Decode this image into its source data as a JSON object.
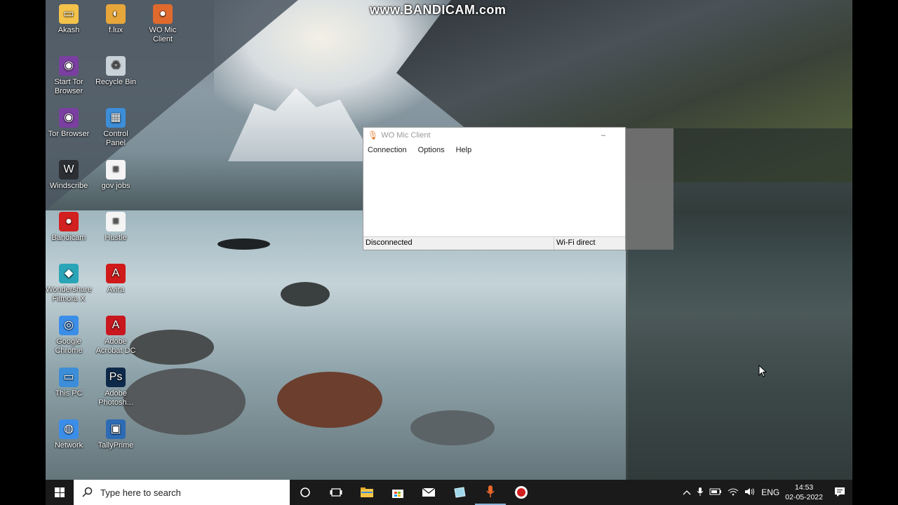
{
  "watermark": "www.BANDICAM.com",
  "desktop_icons": [
    {
      "label": "Akash",
      "icon": "folder-user-icon",
      "color": "#f3c24b"
    },
    {
      "label": "f.lux",
      "icon": "flux-icon",
      "color": "#e6a63a"
    },
    {
      "label": "WO Mic\nClient",
      "icon": "wo-mic-icon",
      "color": "#e06a2e"
    },
    {
      "label": "Start Tor\nBrowser",
      "icon": "tor-start-icon",
      "color": "#7a3fa0"
    },
    {
      "label": "Recycle Bin",
      "icon": "recycle-bin-icon",
      "color": "#c8d2d8"
    },
    {
      "label": "Tor Browser",
      "icon": "tor-browser-icon",
      "color": "#7a3fa0"
    },
    {
      "label": "Control\nPanel",
      "icon": "control-panel-icon",
      "color": "#3c8ed8"
    },
    {
      "label": "Windscribe",
      "icon": "windscribe-icon",
      "color": "#2b2f33"
    },
    {
      "label": "gov jobs",
      "icon": "text-document-icon",
      "color": "#f4f4f4"
    },
    {
      "label": "Bandicam",
      "icon": "bandicam-icon",
      "color": "#d21f1f"
    },
    {
      "label": "Hustle",
      "icon": "text-document-icon",
      "color": "#f4f4f4"
    },
    {
      "label": "Wondershare\nFilmora X",
      "icon": "filmora-icon",
      "color": "#2aa5b8"
    },
    {
      "label": "Avira",
      "icon": "avira-icon",
      "color": "#d01a1a"
    },
    {
      "label": "Google\nChrome",
      "icon": "chrome-icon",
      "color": "#3b8ee8"
    },
    {
      "label": "Adobe\nAcrobat DC",
      "icon": "acrobat-icon",
      "color": "#c8171e"
    },
    {
      "label": "This PC",
      "icon": "this-pc-icon",
      "color": "#3c8ed8"
    },
    {
      "label": "Adobe\nPhotosh...",
      "icon": "photoshop-icon",
      "color": "#0d2a4a"
    },
    {
      "label": "Network",
      "icon": "network-icon",
      "color": "#3b8ee8"
    },
    {
      "label": "TallyPrime",
      "icon": "tallyprime-icon",
      "color": "#2d6bb5"
    }
  ],
  "window": {
    "title": "WO Mic Client",
    "menu": [
      "Connection",
      "Options",
      "Help"
    ],
    "status_left": "Disconnected",
    "status_right": "Wi-Fi direct"
  },
  "taskbar": {
    "search_placeholder": "Type here to search",
    "language": "ENG",
    "time": "14:53",
    "date": "02-05-2022"
  }
}
